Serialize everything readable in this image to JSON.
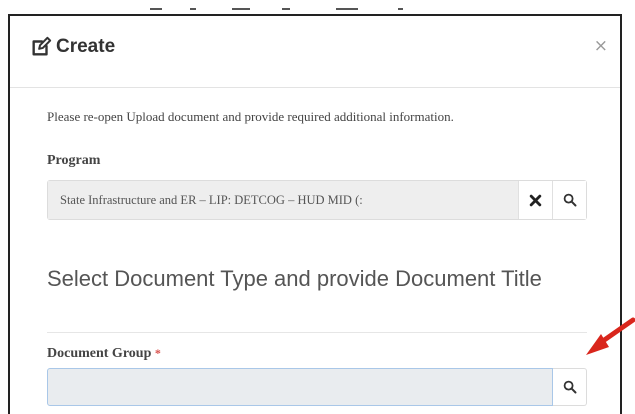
{
  "dialog": {
    "title": "Create",
    "icon": "edit-icon",
    "close_symbol": "×"
  },
  "info": {
    "text": "Please re-open Upload document and provide required additional information."
  },
  "program": {
    "label": "Program",
    "value": "State Infrastructure and ER – LIP: DETCOG – HUD MID (:",
    "clear_icon": "clear-icon",
    "search_icon": "search-icon"
  },
  "section": {
    "heading": "Select Document Type and provide Document Title"
  },
  "document_group": {
    "label": "Document Group",
    "required_marker": "*",
    "value": "",
    "search_icon": "search-icon"
  },
  "annotation": {
    "arrow_color": "#d9261c"
  },
  "colors": {
    "readonly_bg": "#eeeeee",
    "input_bg": "#e9ecef",
    "input_focus_border": "#a9c7e8",
    "required": "#d9534f"
  }
}
